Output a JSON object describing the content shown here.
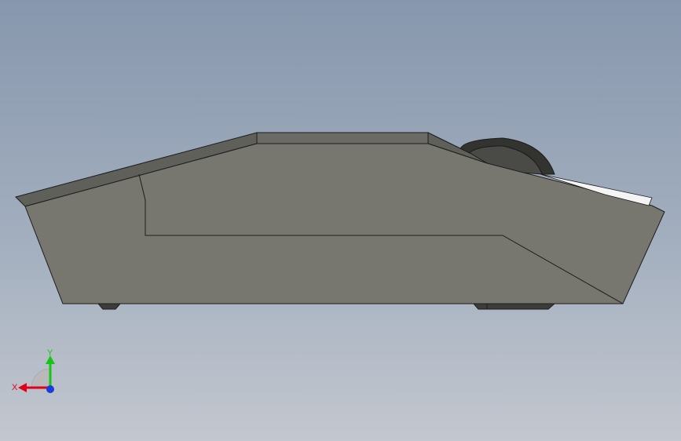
{
  "viewport": {
    "triad": {
      "x_label": "X",
      "y_label": "Y",
      "x_color": "#e0001a",
      "y_color": "#16c516",
      "z_color": "#1a3cdc"
    },
    "model": {
      "body_color": "#77776f",
      "edge_color": "#1c1c1c",
      "top_bevel_color": "#5f605a",
      "roller_color": "#4a4b47",
      "highlight_color": "#f2f2f2"
    }
  }
}
